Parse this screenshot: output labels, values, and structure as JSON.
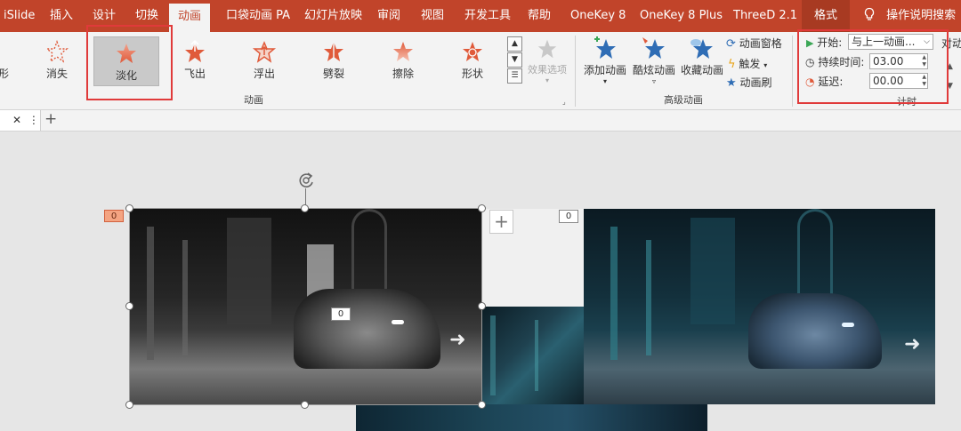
{
  "tabs": [
    {
      "label": "iSlide"
    },
    {
      "label": "插入"
    },
    {
      "label": "设计"
    },
    {
      "label": "切换"
    },
    {
      "label": "动画"
    },
    {
      "label": "口袋动画 PA"
    },
    {
      "label": "幻灯片放映"
    },
    {
      "label": "审阅"
    },
    {
      "label": "视图"
    },
    {
      "label": "开发工具"
    },
    {
      "label": "帮助"
    },
    {
      "label": "OneKey 8"
    },
    {
      "label": "OneKey 8 Plus"
    },
    {
      "label": "ThreeD 2.1"
    },
    {
      "label": "格式"
    }
  ],
  "active_tab": "动画",
  "search": {
    "label": "操作说明搜索",
    "icon": "lightbulb-icon"
  },
  "animation_gallery": {
    "partial_left_label": "形",
    "items": [
      {
        "label": "消失",
        "icon": "disappear-star-icon",
        "color": "#e05a3a"
      },
      {
        "label": "淡化",
        "icon": "fade-star-icon",
        "color": "#e05a3a",
        "selected": true
      },
      {
        "label": "飞出",
        "icon": "fly-out-star-icon",
        "color": "#e05a3a"
      },
      {
        "label": "浮出",
        "icon": "float-out-star-icon",
        "color": "#e05a3a"
      },
      {
        "label": "劈裂",
        "icon": "split-star-icon",
        "color": "#e05a3a"
      },
      {
        "label": "擦除",
        "icon": "wipe-star-icon",
        "color": "#e05a3a"
      },
      {
        "label": "形状",
        "icon": "shape-star-icon",
        "color": "#e05a3a"
      }
    ],
    "effect_options_label": "效果选项",
    "group_label": "动画"
  },
  "advanced": {
    "add_animation_label": "添加动画",
    "cool_animation_label": "酷炫动画",
    "favorite_animation_label": "收藏动画",
    "animation_pane_label": "动画窗格",
    "trigger_label": "触发",
    "painter_label": "动画刷",
    "group_label": "高级动画"
  },
  "timing": {
    "start_label": "开始:",
    "start_value": "与上一动画...",
    "duration_label": "持续时间:",
    "duration_value": "03.00",
    "delay_label": "延迟:",
    "delay_value": "00.00",
    "group_label": "计时",
    "reorder_partial_label": "对动"
  },
  "doc_tab": {
    "close": "✕",
    "more": "⋮",
    "add": "+"
  },
  "slide": {
    "badge_selected": "0",
    "badge_center": "0",
    "badge_right": "0",
    "add_button": "+"
  },
  "colors": {
    "ribbon_red": "#c1442a",
    "highlight_red": "#e03a3a",
    "star_orange": "#e05a3a",
    "star_blue": "#2f6db5"
  }
}
